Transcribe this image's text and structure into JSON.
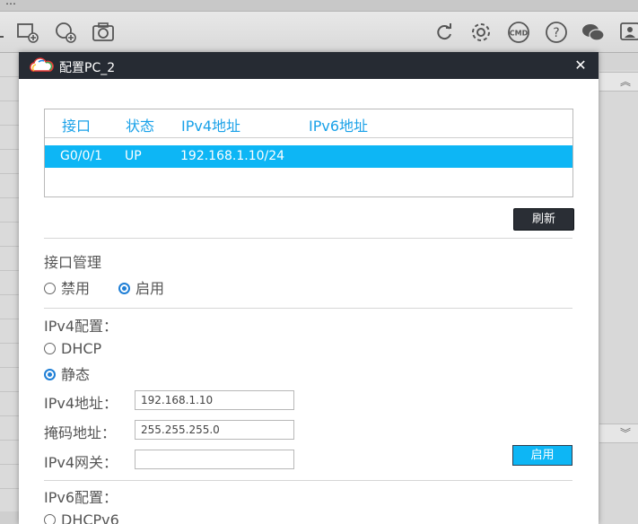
{
  "app": {
    "title_fragment": "…",
    "toolbar_icons": [
      "new-topology-icon",
      "add-device-icon",
      "screenshot-icon",
      "refresh-icon",
      "settings-icon",
      "cmd-icon",
      "help-icon",
      "chat-icon",
      "account-icon"
    ],
    "cmd_label": "CMD"
  },
  "dialog": {
    "title": "配置PC_2",
    "close_glyph": "✕",
    "interface_table": {
      "columns": [
        "接口",
        "状态",
        "IPv4地址",
        "IPv6地址"
      ],
      "rows": [
        {
          "iface": "G0/0/1",
          "status": "UP",
          "ipv4": "192.168.1.10/24",
          "ipv6": ""
        }
      ]
    },
    "refresh_button": "刷新",
    "interface_mgmt": {
      "title": "接口管理",
      "options": [
        "禁用",
        "启用"
      ],
      "selected": "启用"
    },
    "ipv4": {
      "title": "IPv4配置：",
      "options": [
        "DHCP",
        "静态"
      ],
      "selected": "静态",
      "address_label": "IPv4地址：",
      "address_value": "192.168.1.10",
      "mask_label": "掩码地址：",
      "mask_value": "255.255.255.0",
      "gateway_label": "IPv4网关：",
      "gateway_value": "",
      "apply_button": "启用"
    },
    "ipv6": {
      "title": "IPv6配置：",
      "options": [
        "DHCPv6"
      ]
    }
  },
  "colors": {
    "titlebar": "#262b33",
    "accent_blue": "#0db6f5",
    "header_text": "#19a1e8",
    "radio_selected": "#1f7fd6"
  }
}
